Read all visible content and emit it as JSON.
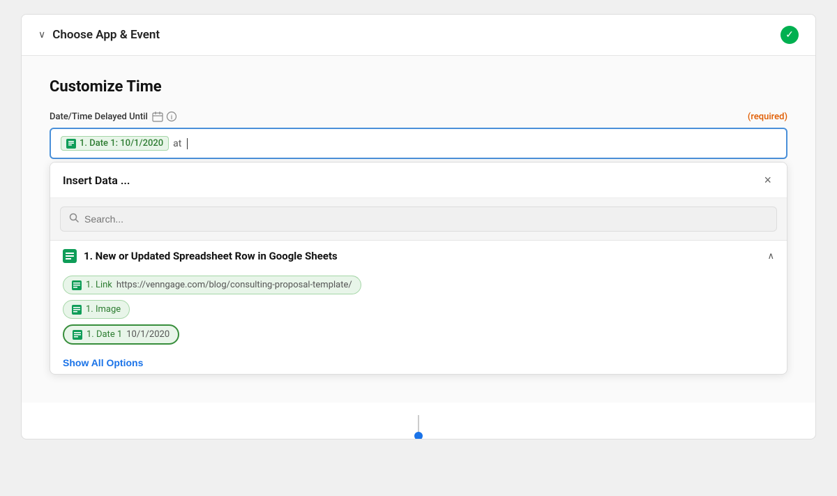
{
  "header": {
    "chevron": "❮",
    "title": "Choose App & Event",
    "check_icon": "✓"
  },
  "customize": {
    "title": "Customize Time",
    "field_label": "Date/Time Delayed Until",
    "required_text": "(required)",
    "input_token_label": "1. Date 1: 10/1/2020",
    "input_after_token": "at"
  },
  "dropdown": {
    "title": "Insert Data ...",
    "close_label": "×",
    "search_placeholder": "Search...",
    "datasource_name": "1. New or Updated Spreadsheet Row in Google Sheets",
    "options": [
      {
        "label": "1. Link",
        "value": "https://venngage.com/blog/consulting-proposal-template/",
        "selected": false
      },
      {
        "label": "1. Image",
        "value": "",
        "selected": false
      },
      {
        "label": "1. Date 1",
        "value": "10/1/2020",
        "selected": true
      }
    ],
    "show_all_label": "Show All Options"
  }
}
